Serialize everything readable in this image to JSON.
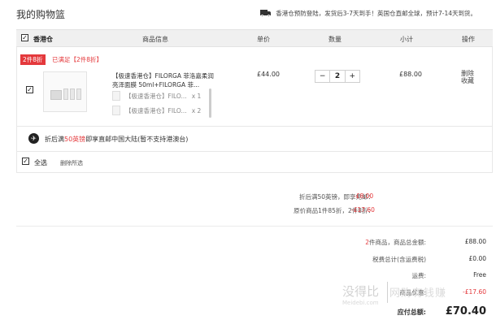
{
  "page_title": "我的购物篮",
  "notice": "香港仓预防登陆，发货后3-7天到手！英国仓直邮全球，预计7-14天到货。",
  "table_header": {
    "store": "香港仓",
    "product_info": "商品信息",
    "unit_price": "单价",
    "quantity": "数量",
    "subtotal": "小计",
    "actions": "操作"
  },
  "promo": {
    "tag": "2件8折",
    "met": "已满足【2件8折】"
  },
  "item": {
    "name": "【极速香港仓】FILORGA 菲洛嘉柔润亮泽面膜 50ml+FILORGA 菲...",
    "sub_items": [
      {
        "name": "【极速香港仓】FILO...",
        "qty": "x 1"
      },
      {
        "name": "【极速香港仓】FILO...",
        "qty": "x 2"
      }
    ],
    "price": "£44.00",
    "qty_minus": "−",
    "qty_value": "2",
    "qty_plus": "+",
    "subtotal": "£88.00",
    "delete": "删除",
    "favorite": "收藏"
  },
  "shipping": {
    "prefix": "折后满",
    "highlight": "50英镑",
    "suffix": "即享直邮中国大陆(暂不支持港澳台)"
  },
  "footer": {
    "select_all": "全选",
    "delete_selected": "删除所选"
  },
  "discounts": [
    {
      "label": "折后满50英镑，即享免邮：",
      "value": "-£8.00"
    },
    {
      "label": "原价商品1件85折，2件8折：",
      "value": "-£17.60"
    }
  ],
  "totals": {
    "count_label_num": "2",
    "count_label": "件商品，商品总金额:",
    "goods_total": "£88.00",
    "tax_label": "税费总计(含运费税)",
    "tax_value": "£0.00",
    "shipping_label": "运费:",
    "shipping_value": "Free",
    "discount_label": "商品优惠:",
    "discount_value": "-£17.60",
    "grand_label": "应付总额:",
    "grand_value": "£70.40"
  },
  "watermark": {
    "brand": "没得比",
    "domain": "Meidebi.com",
    "slogan": "网购有钱赚"
  },
  "colors": {
    "accent_red": "#e4393c",
    "header_bg": "#f0f0f0"
  }
}
